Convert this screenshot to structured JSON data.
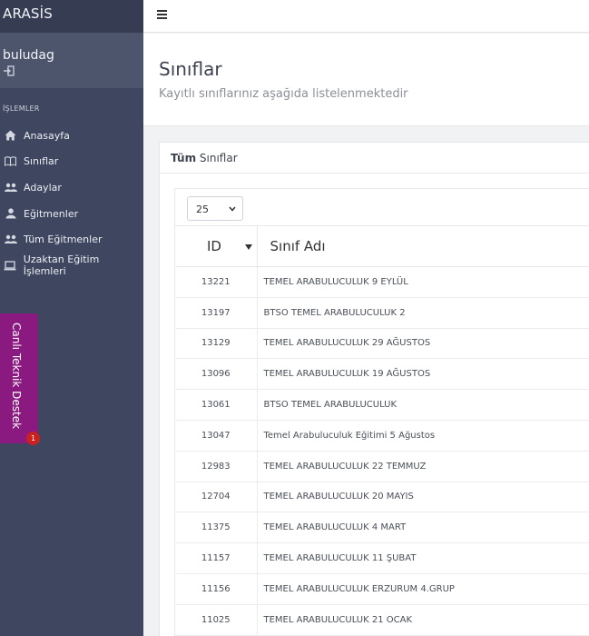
{
  "app": {
    "brand": "ARASİS"
  },
  "user": {
    "name": "buludag"
  },
  "sidebar": {
    "section_title": "İŞLEMLER",
    "items": [
      {
        "label": "Anasayfa",
        "icon": "home-icon"
      },
      {
        "label": "Sınıflar",
        "icon": "book-icon"
      },
      {
        "label": "Adaylar",
        "icon": "users-icon"
      },
      {
        "label": "Eğitmenler",
        "icon": "user-icon"
      },
      {
        "label": "Tüm Eğitmenler",
        "icon": "users-icon"
      },
      {
        "label": "Uzaktan Eğitim İşlemleri",
        "icon": "laptop-icon"
      }
    ]
  },
  "support": {
    "label": "Canlı Teknik Destek",
    "badge": "1"
  },
  "page": {
    "title": "Sınıflar",
    "subtitle": "Kayıtlı sınıflarınız aşağıda listelenmektedir"
  },
  "card": {
    "title_bold": "Tüm",
    "title_rest": " Sınıflar"
  },
  "table": {
    "page_length": "25",
    "columns": [
      "ID",
      "Sınıf Adı"
    ],
    "rows": [
      {
        "id": "13221",
        "name": "TEMEL ARABULUCULUK 9 EYLÜL"
      },
      {
        "id": "13197",
        "name": "BTSO TEMEL ARABULUCULUK 2"
      },
      {
        "id": "13129",
        "name": "TEMEL ARABULUCULUK 29 AĞUSTOS"
      },
      {
        "id": "13096",
        "name": "TEMEL ARABULUCULUK 19 AĞUSTOS"
      },
      {
        "id": "13061",
        "name": "BTSO TEMEL ARABULUCULUK"
      },
      {
        "id": "13047",
        "name": "Temel Arabuluculuk Eğitimi 5 Ağustos"
      },
      {
        "id": "12983",
        "name": "TEMEL ARABULUCULUK 22 TEMMUZ"
      },
      {
        "id": "12704",
        "name": "TEMEL ARABULUCULUK 20 MAYIS"
      },
      {
        "id": "11375",
        "name": "TEMEL ARABULUCULUK 4 MART"
      },
      {
        "id": "11157",
        "name": "TEMEL ARABULUCULUK 11 ŞUBAT"
      },
      {
        "id": "11156",
        "name": "TEMEL ARABULUCULUK ERZURUM 4.GRUP"
      },
      {
        "id": "11025",
        "name": "TEMEL ARABULUCULUK 21 OCAK"
      }
    ]
  }
}
